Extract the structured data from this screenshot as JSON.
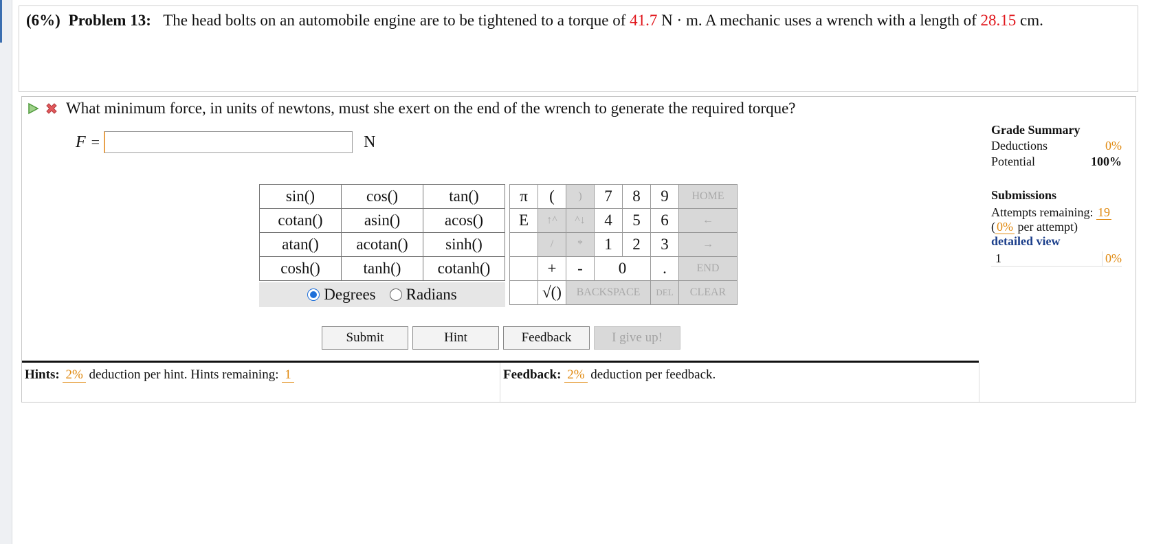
{
  "problem": {
    "weight": "(6%)",
    "label": "Problem 13:",
    "text1": "The head bolts on an automobile engine are to be tightened to a torque of",
    "torque_value": "41.7",
    "text2": "N · m. A mechanic uses a wrench with a length of",
    "length_value": "28.15",
    "text3": "cm."
  },
  "question": {
    "text": "What minimum force, in units of newtons, must she exert on the end of the wrench to generate the required torque?",
    "var": "F",
    "eq": "=",
    "unit": "N",
    "value": ""
  },
  "functions": [
    [
      "sin()",
      "cos()",
      "tan()"
    ],
    [
      "cotan()",
      "asin()",
      "acos()"
    ],
    [
      "atan()",
      "acotan()",
      "sinh()"
    ],
    [
      "cosh()",
      "tanh()",
      "cotanh()"
    ]
  ],
  "angle": {
    "degrees": "Degrees",
    "radians": "Radians",
    "selected": "Degrees"
  },
  "keypad": {
    "pi": "π",
    "lparen": "(",
    "rparen": ")",
    "k7": "7",
    "k8": "8",
    "k9": "9",
    "home": "HOME",
    "e": "E",
    "up": "↑^",
    "down": "^↓",
    "k4": "4",
    "k5": "5",
    "k6": "6",
    "left": "←",
    "slash": "/",
    "star": "*",
    "k1": "1",
    "k2": "2",
    "k3": "3",
    "right": "→",
    "plus": "+",
    "minus": "-",
    "k0": "0",
    "dot": ".",
    "end": "END",
    "sqrt": "√()",
    "backspace": "BACKSPACE",
    "del": "DEL",
    "clear": "CLEAR"
  },
  "buttons": {
    "submit": "Submit",
    "hint": "Hint",
    "feedback": "Feedback",
    "give_up": "I give up!"
  },
  "hints": {
    "label": "Hints:",
    "pct": "2%",
    "text": "deduction per hint. Hints remaining:",
    "remaining": "1"
  },
  "feedback": {
    "label": "Feedback:",
    "pct": "2%",
    "text": "deduction per feedback."
  },
  "grade_summary": {
    "title": "Grade Summary",
    "deductions_label": "Deductions",
    "deductions_value": "0%",
    "potential_label": "Potential",
    "potential_value": "100%"
  },
  "submissions": {
    "title": "Submissions",
    "attempts_label": "Attempts remaining:",
    "attempts_value": "19",
    "per_open": "(",
    "per_value": "0%",
    "per_text": "per attempt)",
    "detailed": "detailed view",
    "row_num": "1",
    "row_value": "0%"
  },
  "colors": {
    "given_value": "#e0141a",
    "accent": "#e0890f",
    "link": "#1c3f8b",
    "radio": "#1e6fd9"
  }
}
